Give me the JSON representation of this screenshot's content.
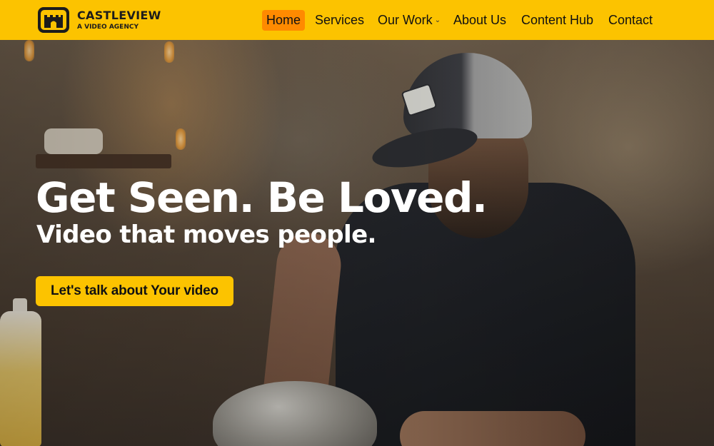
{
  "brand": {
    "name": "CASTLEVIEW",
    "tagline": "A VIDEO AGENCY",
    "logo_icon": "castle-icon"
  },
  "nav": {
    "items": [
      {
        "label": "Home",
        "active": true
      },
      {
        "label": "Services"
      },
      {
        "label": "Our Work",
        "has_dropdown": true
      },
      {
        "label": "About Us"
      },
      {
        "label": "Content Hub"
      },
      {
        "label": "Contact"
      }
    ]
  },
  "hero": {
    "headline": "Get Seen. Be Loved.",
    "subheadline": "Video that moves people.",
    "cta_label": "Let's talk about Your video"
  },
  "colors": {
    "brand_yellow": "#fcc300",
    "active_nav": "#ff8a00",
    "text_dark": "#111111",
    "hero_text": "#ffffff"
  }
}
